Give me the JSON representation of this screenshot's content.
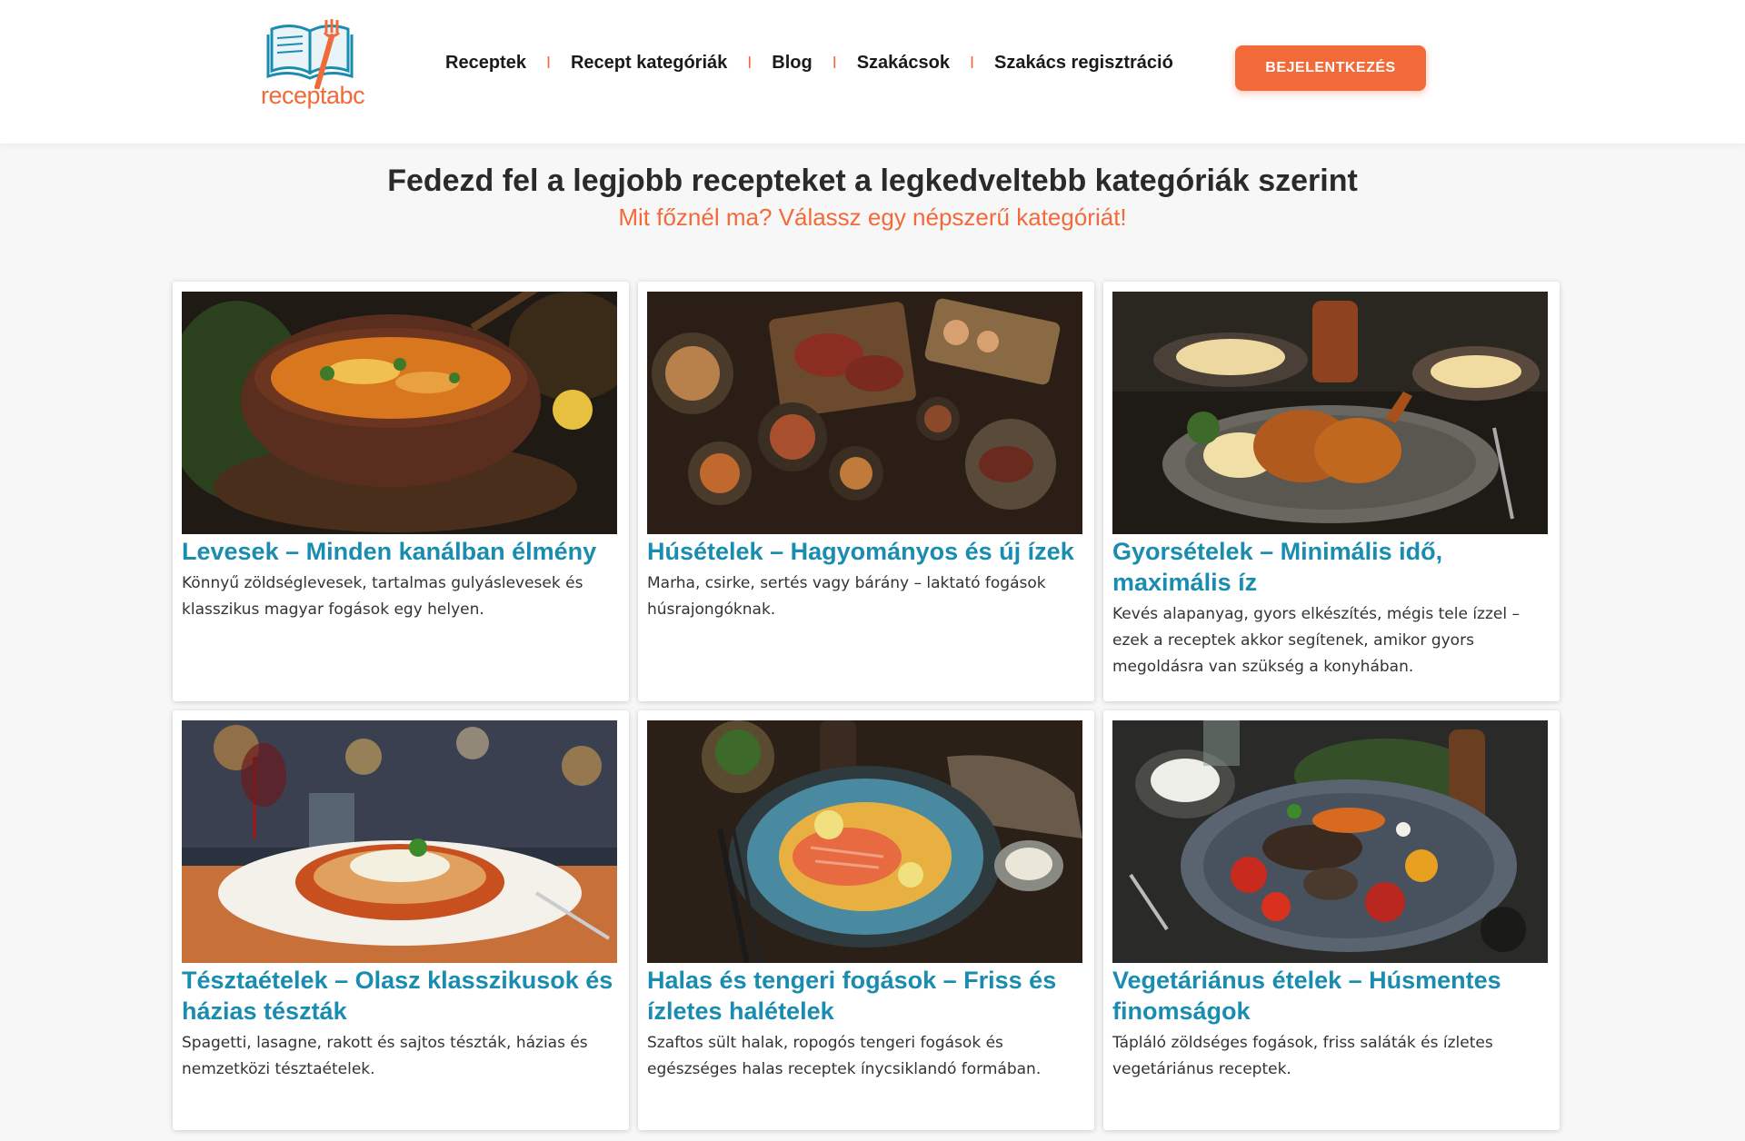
{
  "brand": {
    "logo_text": "receptabc"
  },
  "nav": {
    "items": [
      {
        "label": "Receptek"
      },
      {
        "label": "Recept kategóriák"
      },
      {
        "label": "Blog"
      },
      {
        "label": "Szakácsok"
      },
      {
        "label": "Szakács regisztráció"
      }
    ],
    "separator": "I"
  },
  "header": {
    "login_label": "BEJELENTKEZÉS"
  },
  "hero": {
    "title": "Fedezd fel a legjobb recepteket a legkedveltebb kategóriák szerint",
    "subtitle": "Mit főznél ma? Válassz egy népszerű kategóriát!"
  },
  "categories": [
    {
      "title": "Levesek – Minden kanálban élmény",
      "desc": "Könnyű zöldséglevesek, tartalmas gulyáslevesek és klasszikus magyar fogások egy helyen.",
      "image": "soup-pot-image"
    },
    {
      "title": "Húsételek – Hagyományos és új ízek",
      "desc": "Marha, csirke, sertés vagy bárány – laktató fogások húsrajongóknak.",
      "image": "meat-table-image"
    },
    {
      "title": "Gyorsételek – Minimális idő, maximális íz",
      "desc": "Kevés alapanyag, gyors elkészítés, mégis tele ízzel – ezek a receptek akkor segítenek, amikor gyors megoldásra van szükség a konyhában.",
      "image": "roast-chicken-image"
    },
    {
      "title": "Tésztaételek – Olasz klasszikusok és házias tészták",
      "desc": "Spagetti, lasagne, rakott és sajtos tészták, házias és nemzetközi tésztaételek.",
      "image": "spaghetti-image"
    },
    {
      "title": "Halas és tengeri fogások – Friss és ízletes halételek",
      "desc": "Szaftos sült halak, ropogós tengeri fogások és egészséges halas receptek ínycsiklandó formában.",
      "image": "salmon-plate-image"
    },
    {
      "title": "Vegetáriánus ételek – Húsmentes finomságok",
      "desc": "Tápláló zöldséges fogások, friss saláták és ízletes vegetáriánus receptek.",
      "image": "grilled-vegetables-image"
    }
  ],
  "colors": {
    "accent": "#f26a3a",
    "link": "#1a8cb0",
    "logo_book": "#1a8cb0"
  }
}
